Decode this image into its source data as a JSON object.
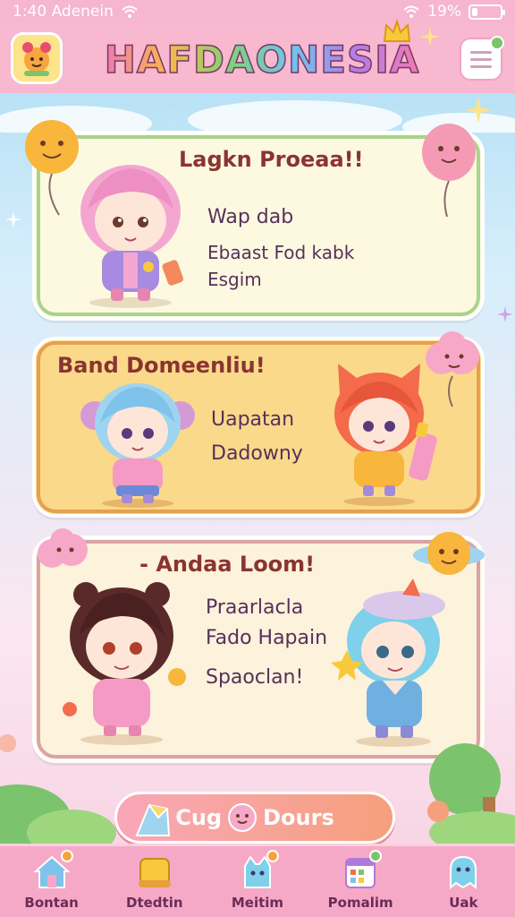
{
  "status_bar": {
    "left_text": "1:40 Adenein",
    "battery": "19%",
    "battery_level": 0.19
  },
  "header": {
    "title": "HAFDAONESIA",
    "menu_icon": "hamburger-icon",
    "logo_icon": "mascot-logo-icon"
  },
  "cards": [
    {
      "title": "Lagkn Proeaa!!",
      "lines": [
        "Wap dab",
        "Ebaast Fod kabk",
        "Esgim"
      ]
    },
    {
      "title": "Band Domeenliu!",
      "lines": [
        "Uapatan",
        "Dadowny"
      ]
    },
    {
      "title": "- Andaa Loom!",
      "lines": [
        "Praarlacla",
        "Fado Hapain",
        "Spaoclan!"
      ]
    }
  ],
  "cta": {
    "label_left": "Cug",
    "label_right": "Dours"
  },
  "bottom_nav": [
    {
      "label": "Bontan",
      "icon": "home-icon"
    },
    {
      "label": "Dtedtin",
      "icon": "scroll-icon"
    },
    {
      "label": "Meitim",
      "icon": "pet-icon"
    },
    {
      "label": "Pomalim",
      "icon": "calendar-icon"
    },
    {
      "label": "Uak",
      "icon": "ghost-icon"
    }
  ],
  "colors": {
    "header_bg": "#f7b8d0",
    "nav_bg": "#f6a9c6",
    "card_title": "#8a3432",
    "accent_pink": "#f07ab0"
  }
}
